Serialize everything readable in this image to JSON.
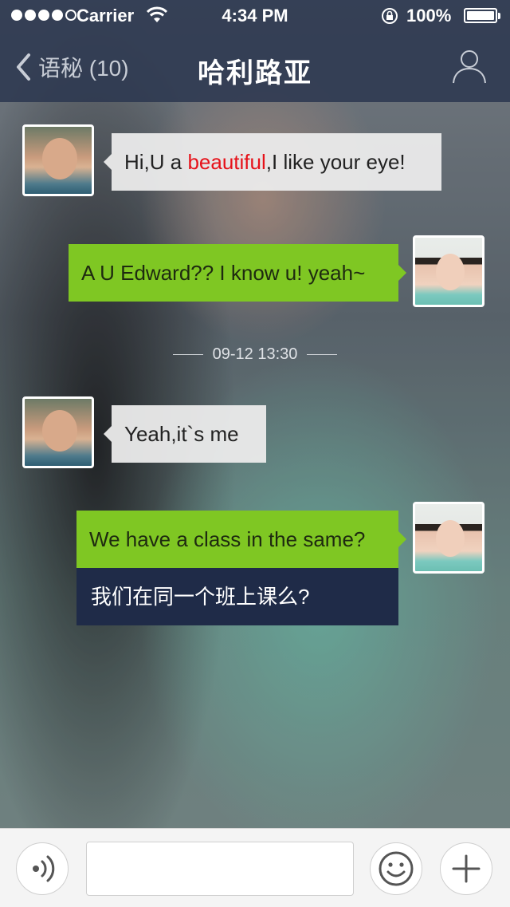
{
  "status_bar": {
    "carrier": "Carrier",
    "time": "4:34 PM",
    "battery": "100%",
    "signal_bars_filled": 4,
    "signal_bars_total": 5
  },
  "nav": {
    "back_label": "语秘 (10)",
    "title": "哈利路亚"
  },
  "messages": [
    {
      "sender": "other",
      "text_before": "Hi,U a ",
      "text_highlight": "beautiful",
      "text_after": ",I like your eye!"
    },
    {
      "sender": "me",
      "text": "A U Edward?? I know u! yeah~"
    },
    {
      "sender": "other",
      "text": "Yeah,it`s me"
    },
    {
      "sender": "me",
      "text": "We have a class in the same?",
      "translation": "我们在同一个班上课么?"
    }
  ],
  "timestamp": "09-12 13:30",
  "input_bar": {
    "voice_icon": "voice-icon",
    "emoji_icon": "emoji-icon",
    "add_icon": "plus-icon",
    "input_value": "",
    "input_placeholder": ""
  },
  "colors": {
    "nav_bg": "#2c3850",
    "green_bubble": "#7fc723",
    "white_bubble": "#ebebeb",
    "translation_bg": "#1f2b48",
    "highlight": "#e6121a"
  }
}
